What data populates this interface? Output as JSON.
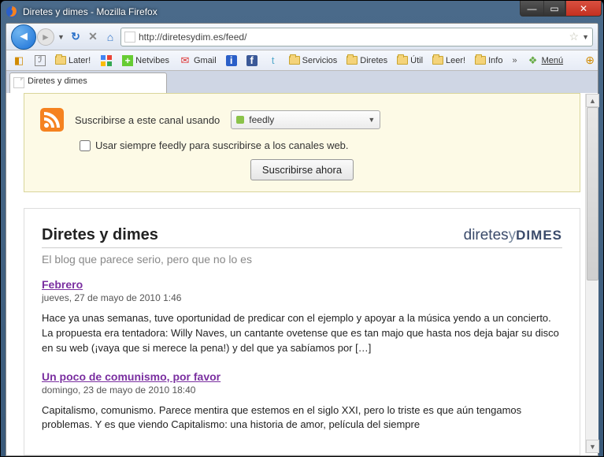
{
  "window": {
    "title": "Diretes y dimes - Mozilla Firefox"
  },
  "nav": {
    "url": "http://diretesydim.es/feed/"
  },
  "bookmarks": {
    "later": "Later!",
    "netvibes": "Netvibes",
    "gmail": "Gmail",
    "servicios": "Servicios",
    "diretes": "Diretes",
    "util": "Útil",
    "leer": "Leer!",
    "info": "Info",
    "menu": "Menú"
  },
  "tab": {
    "title": "Diretes y dimes"
  },
  "subscribe": {
    "label": "Suscribirse a este canal usando",
    "selected": "feedly",
    "always": "Usar siempre feedly para suscribirse a los canales web.",
    "button": "Suscribirse ahora"
  },
  "feed": {
    "title": "Diretes y dimes",
    "logo_a": "diretes",
    "logo_b": "y",
    "logo_c": "DIMES",
    "tagline": "El blog que parece serio, pero que no lo es",
    "posts": [
      {
        "title": "Febrero",
        "date": "jueves, 27 de mayo de 2010 1:46",
        "body": "Hace ya unas semanas, tuve oportunidad de predicar con el ejemplo y apoyar a la música yendo a un concierto. La propuesta era tentadora: Willy Naves, un cantante ovetense que es tan majo que hasta nos deja bajar su disco en su web (¡vaya que si merece la pena!) y del que ya sabíamos por […]"
      },
      {
        "title": "Un poco de comunismo, por favor",
        "date": "domingo, 23 de mayo de 2010 18:40",
        "body": "Capitalismo, comunismo. Parece mentira que estemos en el siglo XXI, pero lo triste es que aún tengamos problemas. Y es que viendo Capitalismo: una historia de amor, película del siempre"
      }
    ]
  }
}
